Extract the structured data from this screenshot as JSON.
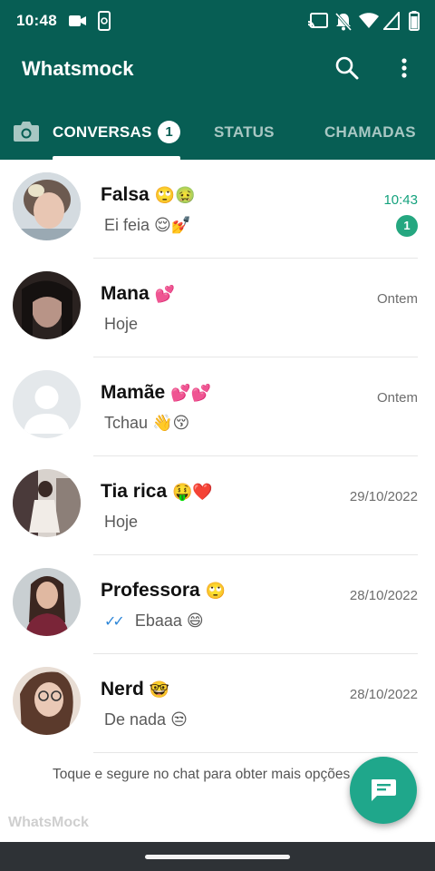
{
  "status_bar": {
    "time": "10:48"
  },
  "app_bar": {
    "title": "Whatsmock"
  },
  "tabs": {
    "conversas": "CONVERSAS",
    "conversas_badge": "1",
    "status": "STATUS",
    "chamadas": "CHAMADAS"
  },
  "chats": [
    {
      "name": "Falsa",
      "name_emoji": "🙄🤢",
      "message": "Ei feia",
      "message_emoji": "😌💅",
      "time": "10:43",
      "unread": "1",
      "avatar_colors": [
        "#cfd7dd",
        "#7b6a5f"
      ]
    },
    {
      "name": "Mana",
      "name_emoji": "💕",
      "message": "Hoje",
      "message_emoji": "",
      "time": "Ontem",
      "unread": "",
      "avatar_colors": [
        "#2a2220",
        "#a8857a"
      ]
    },
    {
      "name": "Mamãe",
      "name_emoji": "💕💕",
      "message": "Tchau",
      "message_emoji": "👋😚",
      "time": "Ontem",
      "unread": "",
      "avatar_colors": [
        "#e6eaed",
        "#ffffff"
      ]
    },
    {
      "name": "Tia rica",
      "name_emoji": "🤑❤️",
      "message": "Hoje",
      "message_emoji": "",
      "time": "29/10/2022",
      "unread": "",
      "avatar_colors": [
        "#4a3a3a",
        "#dcd4cf"
      ]
    },
    {
      "name": "Professora",
      "name_emoji": "🙄",
      "message": "Ebaaa",
      "message_emoji": "😄",
      "time": "28/10/2022",
      "unread": "",
      "avatar_colors": [
        "#c9cfd2",
        "#7a2538"
      ]
    },
    {
      "name": "Nerd",
      "name_emoji": "🤓",
      "message": "De nada",
      "message_emoji": "😒",
      "time": "28/10/2022",
      "unread": "",
      "avatar_colors": [
        "#d9c9bd",
        "#5b3a2c"
      ]
    }
  ],
  "hint_text": "Toque e segure no chat para obter mais opções",
  "watermark": "WhatsMock",
  "colors": {
    "primary": "#075e54",
    "accent": "#25a780",
    "fab": "#1fa78b",
    "read_ticks": "#2f87d8"
  }
}
